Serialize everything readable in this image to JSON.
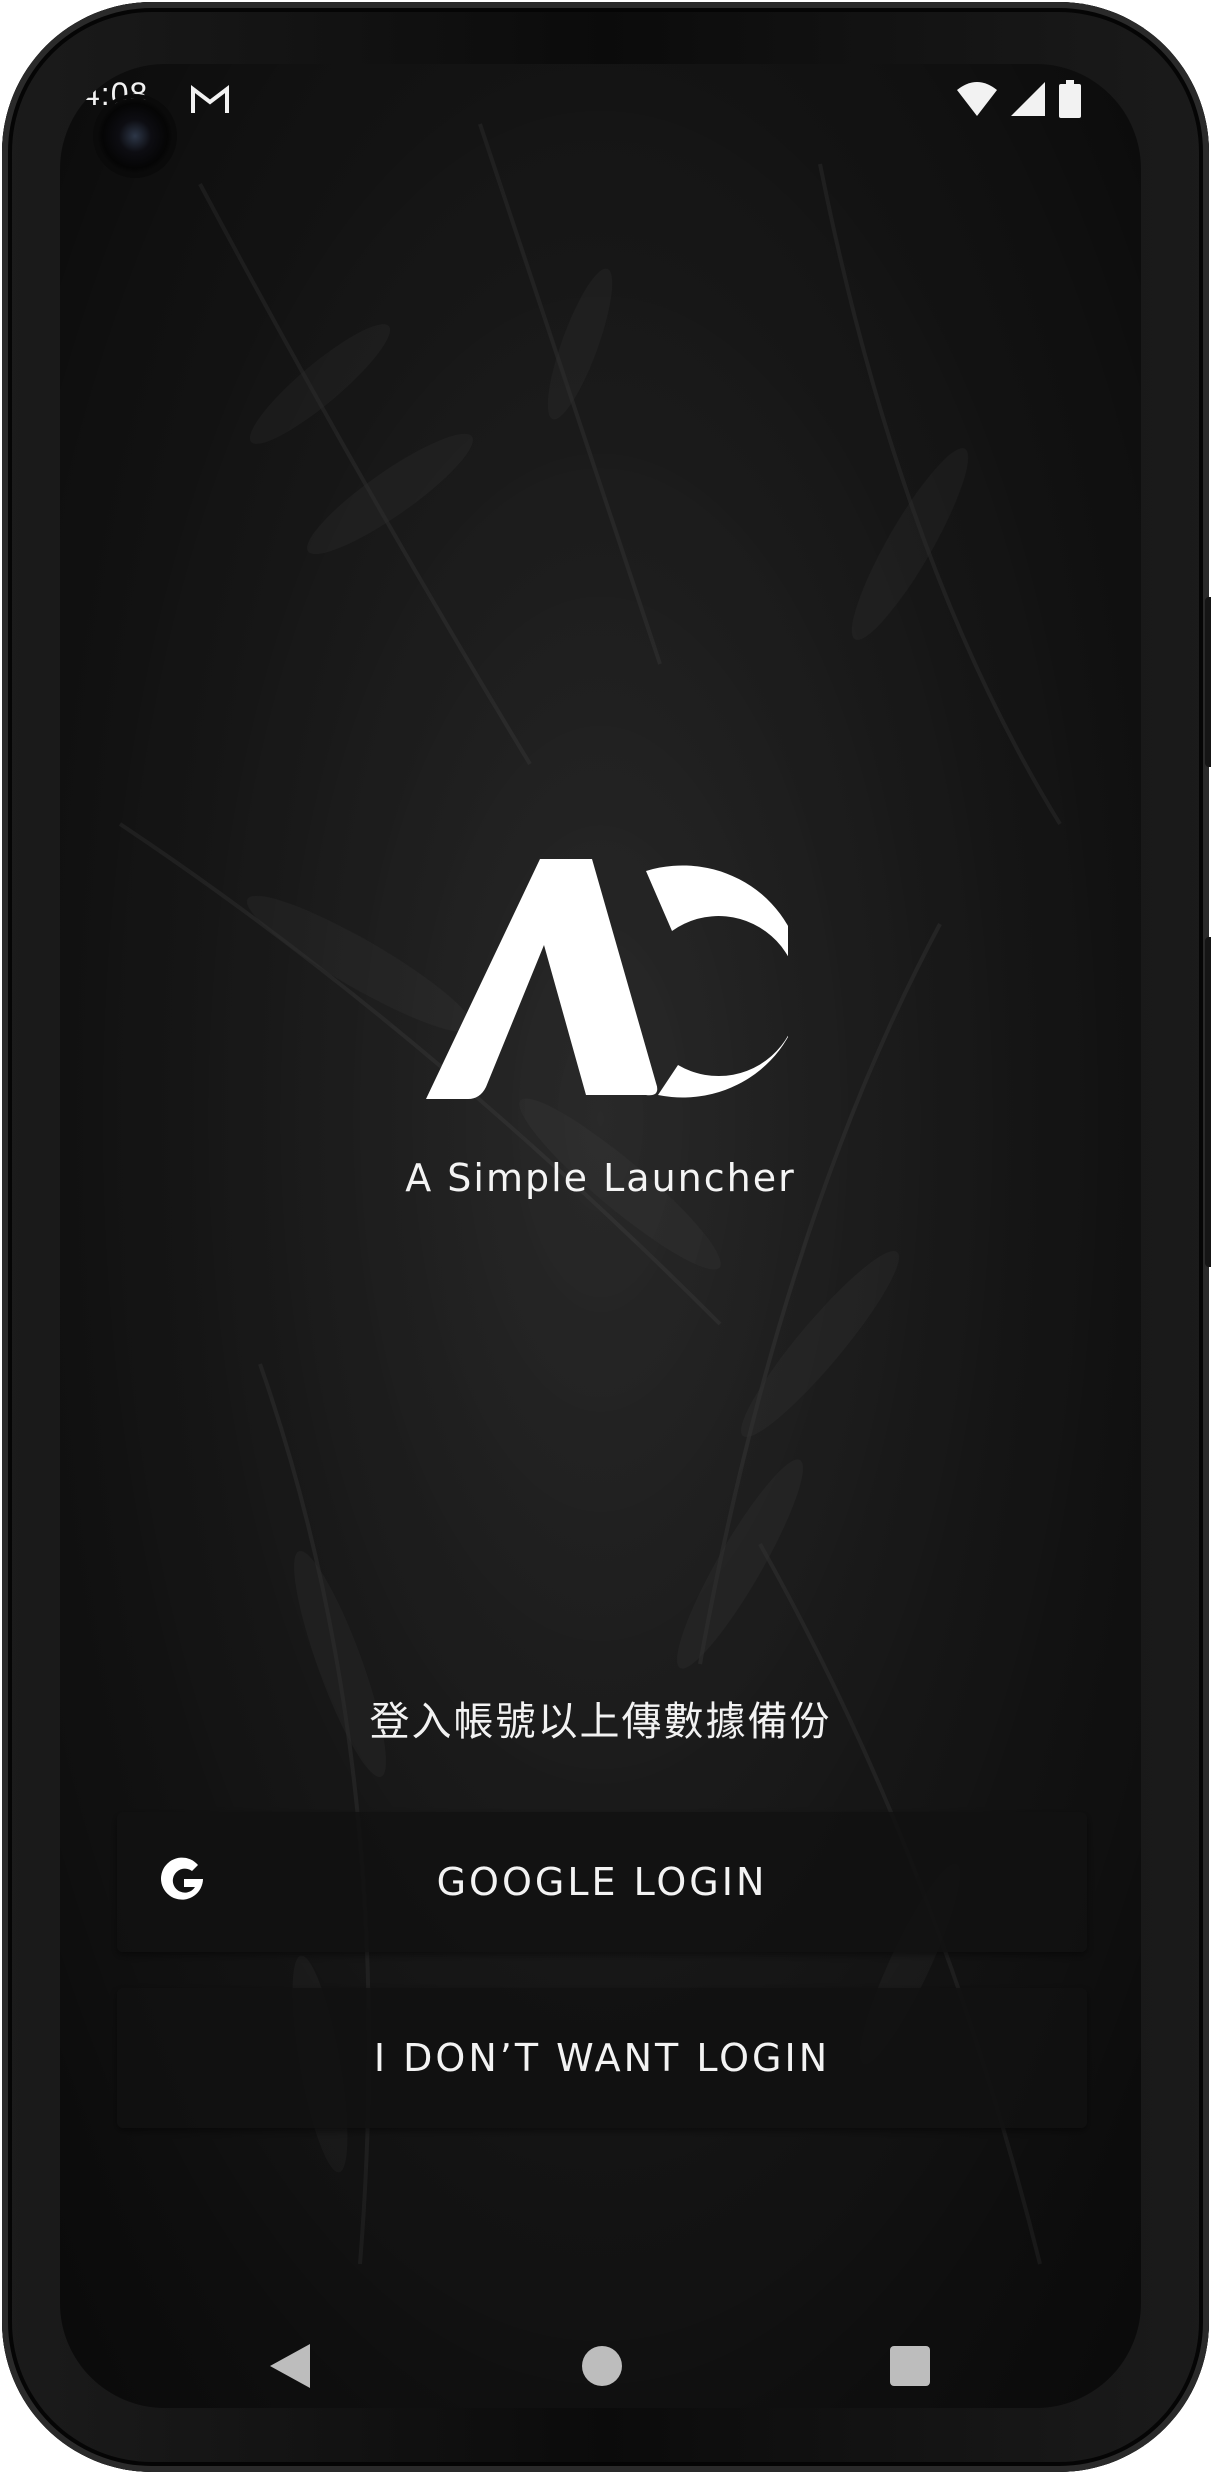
{
  "status_bar": {
    "time": "4:08",
    "notification_icons": [
      "gmail-icon"
    ],
    "system_icons": [
      "wifi-icon",
      "cell-signal-icon",
      "battery-icon"
    ]
  },
  "logo": {
    "alt": "AC logo"
  },
  "app": {
    "name": "A Simple Launcher"
  },
  "login": {
    "prompt": "登入帳號以上傳數據備份",
    "google_button_label": "GOOGLE LOGIN",
    "skip_button_label": "I DON’T WANT LOGIN"
  },
  "nav_bar": {
    "buttons": [
      "back-icon",
      "home-icon",
      "recents-icon"
    ]
  },
  "colors": {
    "background": "#1e1e1e",
    "button_background": "#111111",
    "text": "#f2f2f2",
    "nav_icons": "#bdbdbd"
  }
}
